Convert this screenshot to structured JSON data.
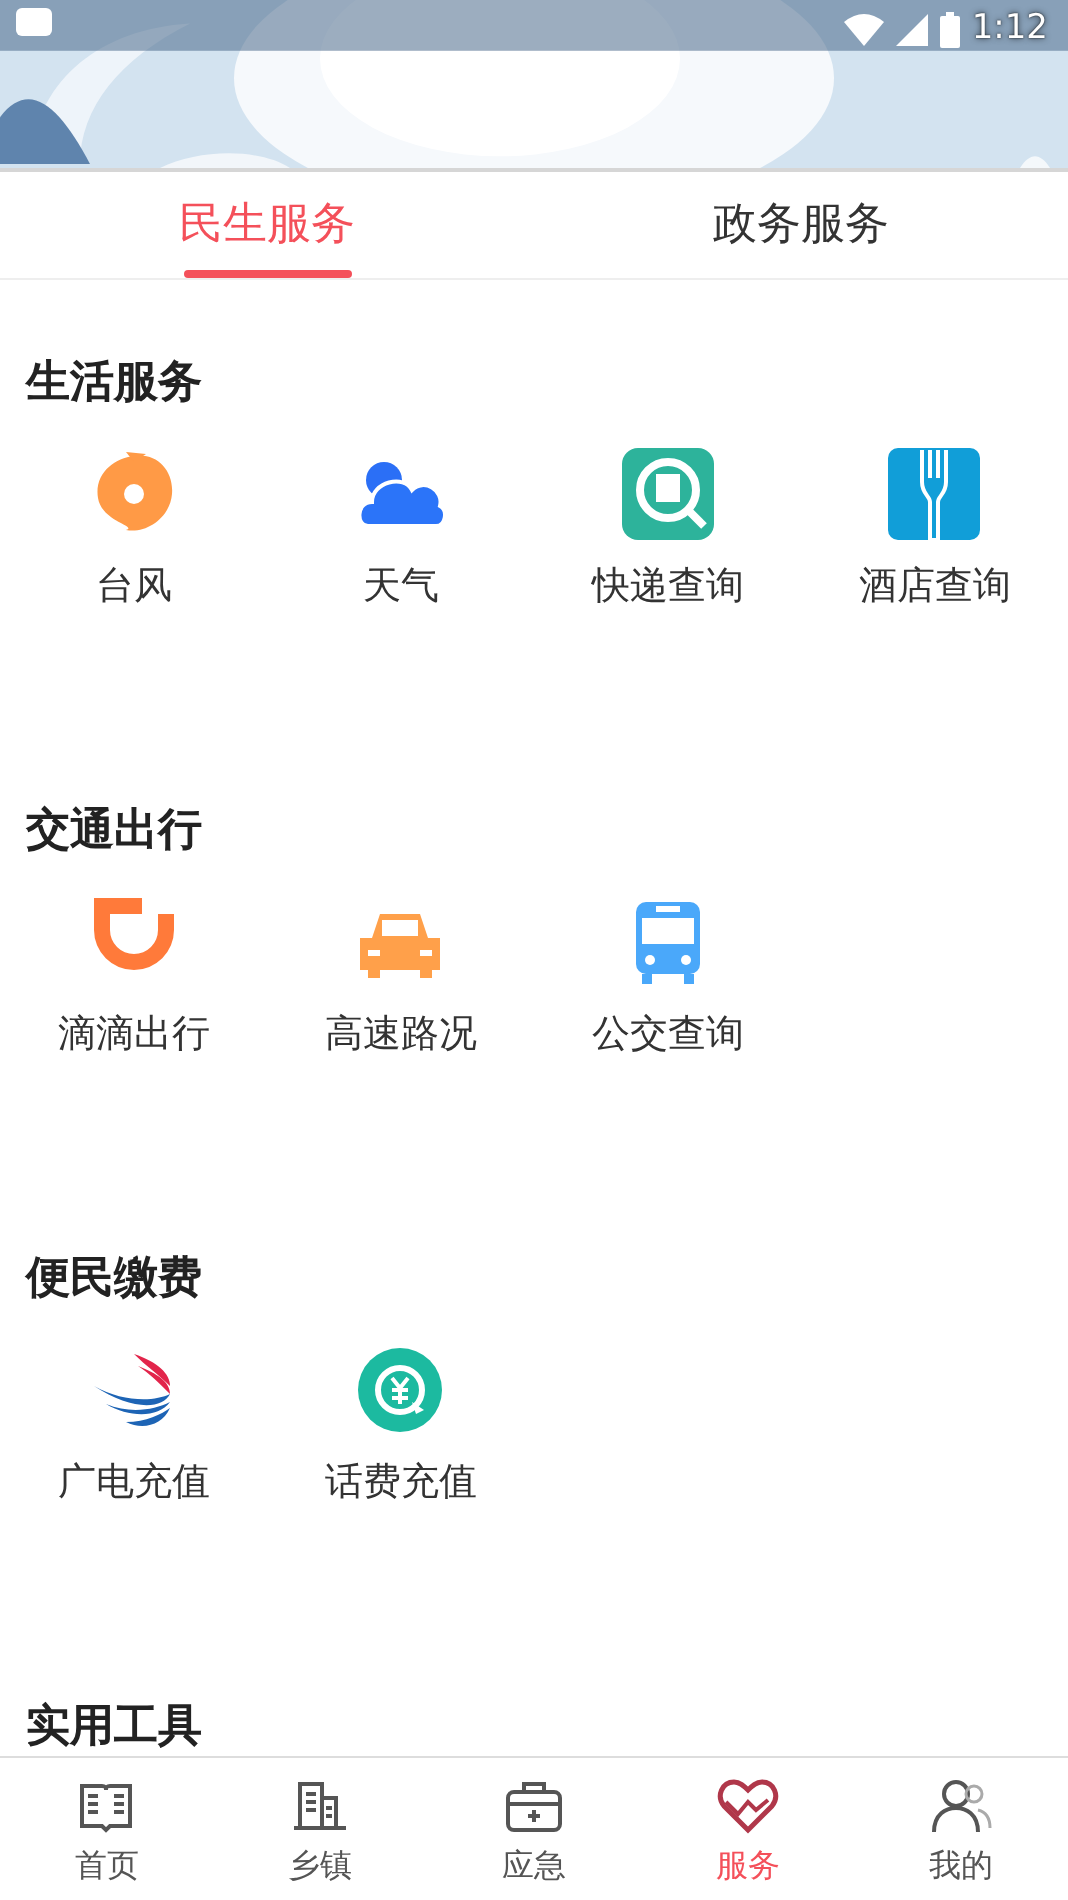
{
  "status_bar": {
    "time": "1:12"
  },
  "tabs": [
    {
      "label": "民生服务",
      "selected": true
    },
    {
      "label": "政务服务",
      "selected": false
    }
  ],
  "sections": [
    {
      "title": "生活服务",
      "items": [
        {
          "label": "台风"
        },
        {
          "label": "天气"
        },
        {
          "label": "快递查询"
        },
        {
          "label": "酒店查询"
        }
      ]
    },
    {
      "title": "交通出行",
      "items": [
        {
          "label": "滴滴出行"
        },
        {
          "label": "高速路况"
        },
        {
          "label": "公交查询"
        }
      ]
    },
    {
      "title": "便民缴费",
      "items": [
        {
          "label": "广电充值"
        },
        {
          "label": "话费充值"
        }
      ]
    },
    {
      "title": "实用工具"
    }
  ],
  "bottom_nav": [
    {
      "label": "首页",
      "selected": false
    },
    {
      "label": "乡镇",
      "selected": false
    },
    {
      "label": "应急",
      "selected": false
    },
    {
      "label": "服务",
      "selected": true
    },
    {
      "label": "我的",
      "selected": false
    }
  ]
}
